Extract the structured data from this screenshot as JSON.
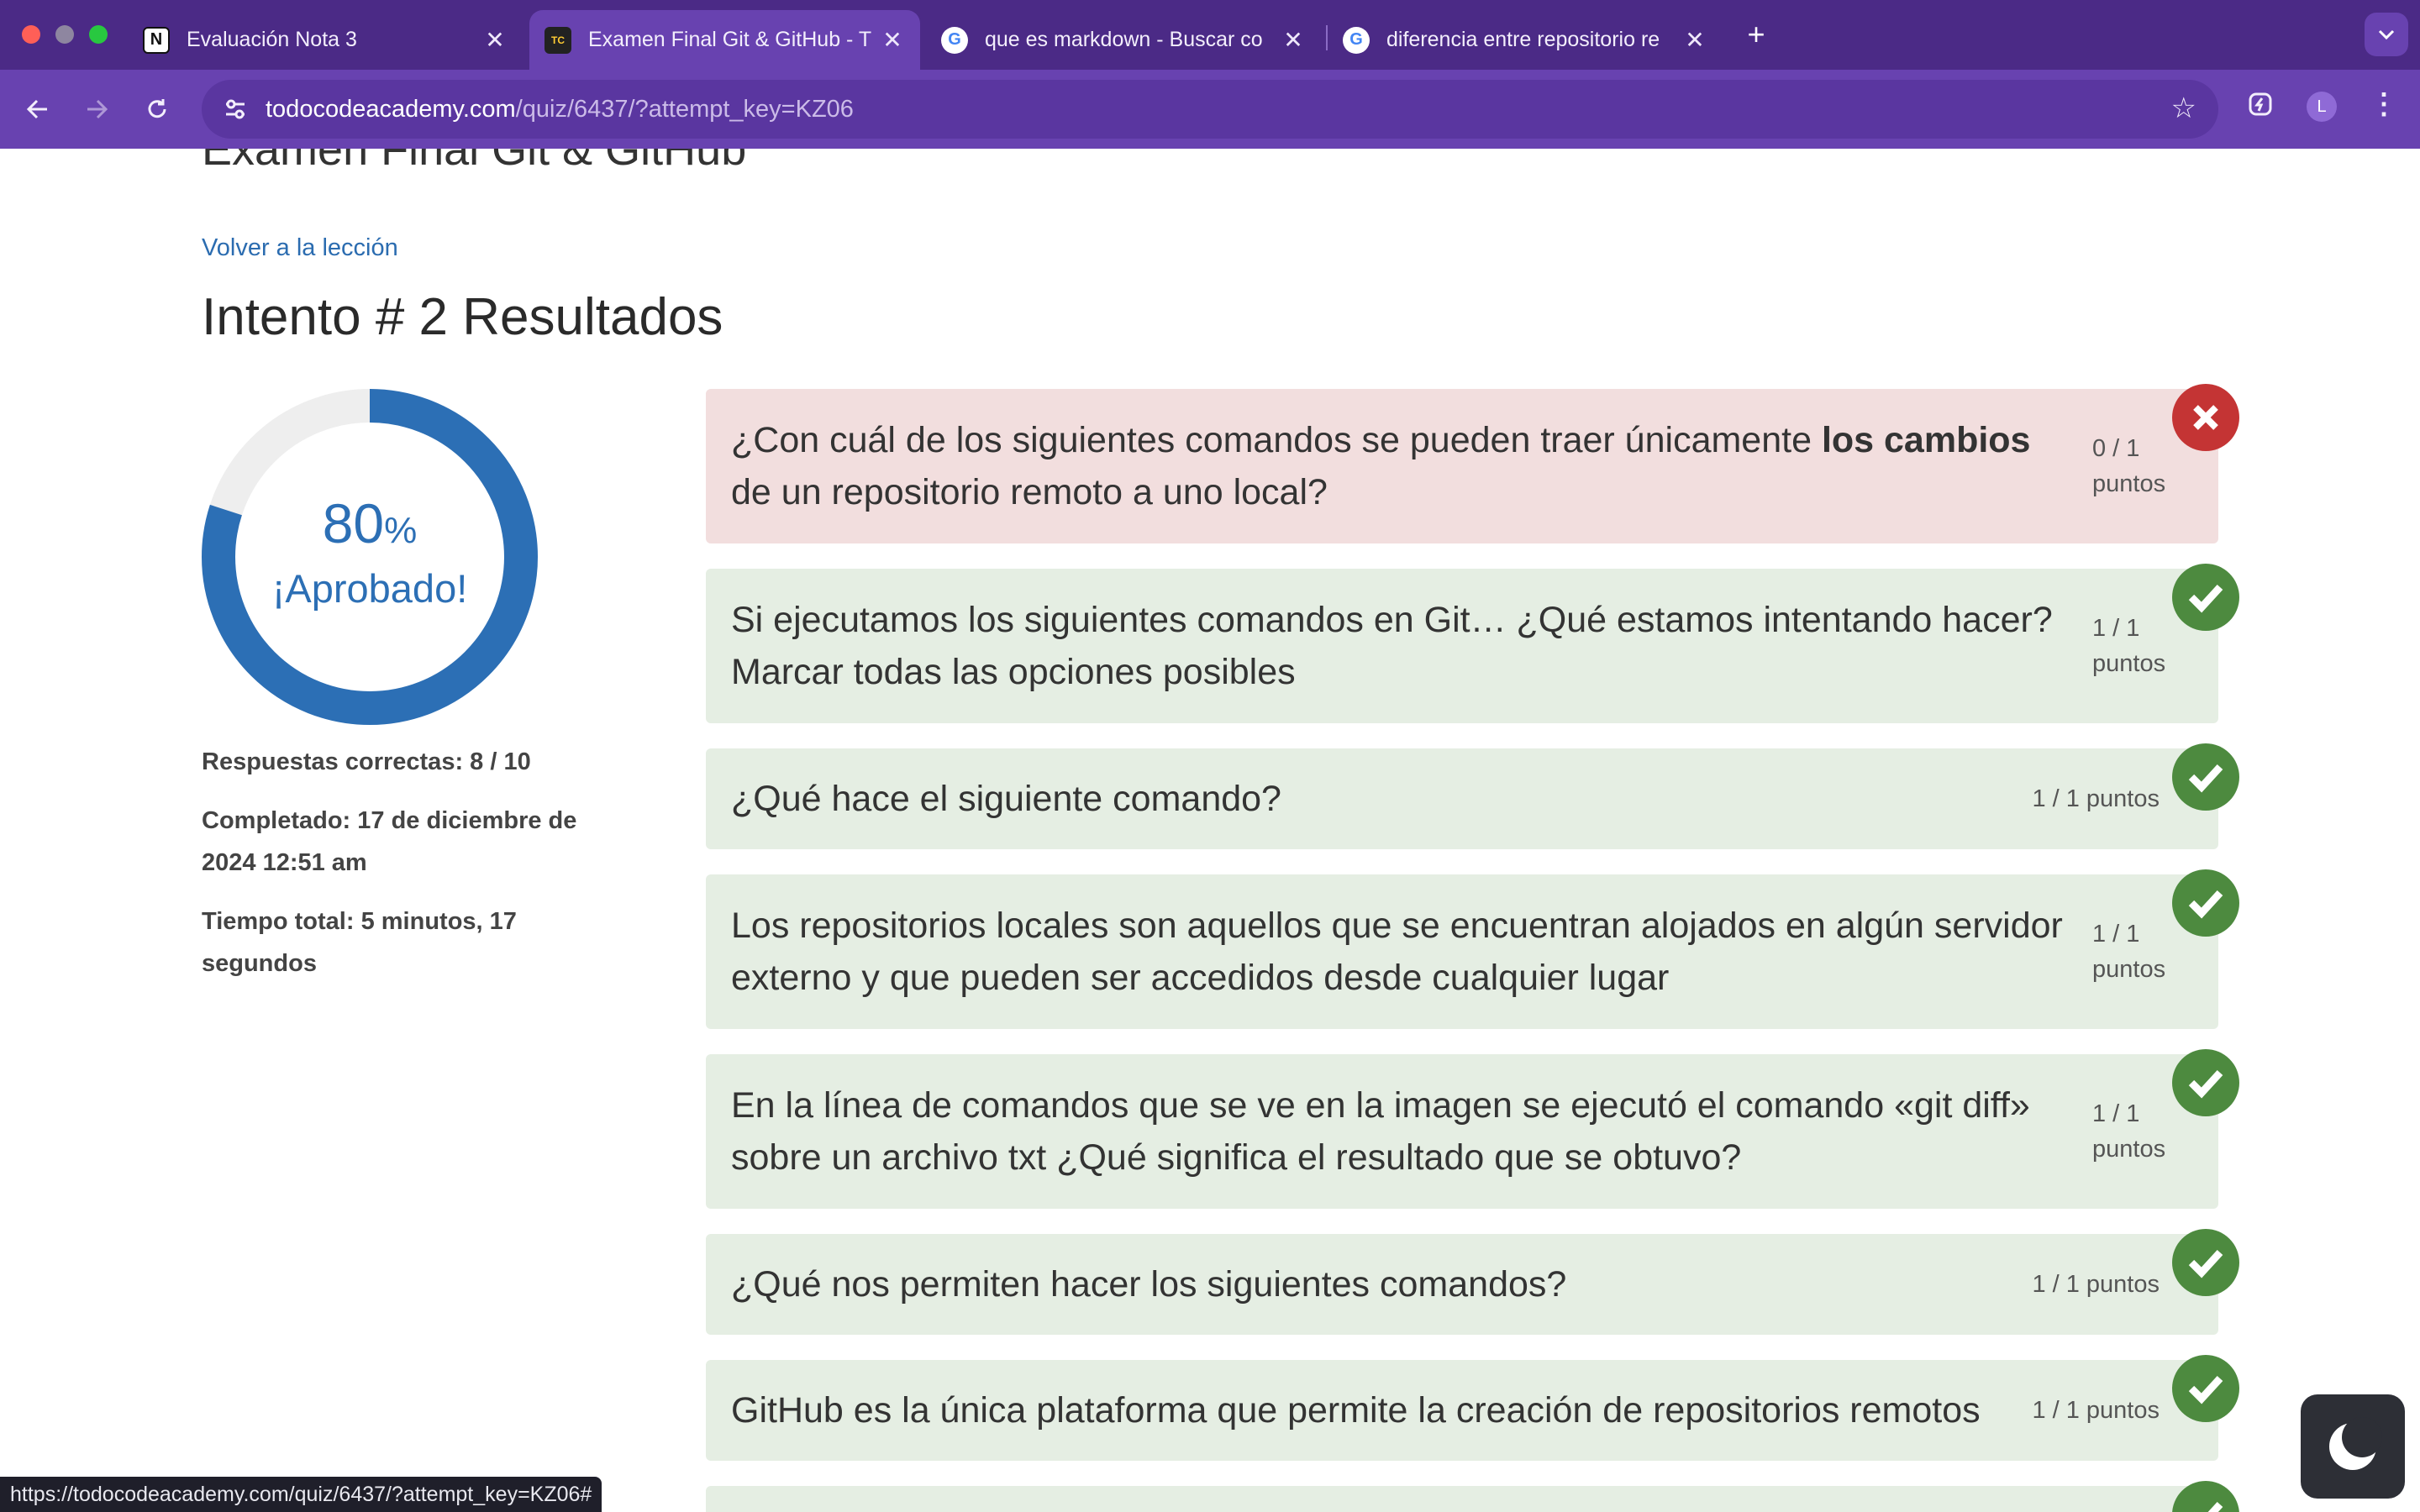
{
  "tabs": [
    {
      "title": "Evaluación Nota 3",
      "icon": "notion-icon"
    },
    {
      "title": "Examen Final Git & GitHub - T",
      "icon": "todocode-icon"
    },
    {
      "title": "que es markdown - Buscar co",
      "icon": "google-icon"
    },
    {
      "title": "diferencia entre repositorio re",
      "icon": "google-icon"
    }
  ],
  "omnibox": {
    "domain": "todocodeacademy.com",
    "path": "/quiz/6437/?attempt_key=KZ06"
  },
  "avatar_letter": "L",
  "page": {
    "exam_title": "Examen Final Git & GitHub",
    "back_link": "Volver a la lección",
    "attempt_heading": "Intento # 2 Resultados",
    "score_percent": 80,
    "score_number": "80",
    "score_symbol": "%",
    "score_status": "¡Aprobado!",
    "correct_answers": "Respuestas correctas: 8 / 10",
    "completed": "Completado: 17 de diciembre de 2024 12:51 am",
    "total_time": "Tiempo total: 5 minutos, 17 segundos"
  },
  "questions": [
    {
      "text_before": "¿Con cuál de los siguientes comandos se pueden traer únicamente ",
      "text_bold": "los cambios",
      "text_after": " de un repositorio remoto a uno local?",
      "score": "0 / 1",
      "unit": "puntos",
      "correct": false
    },
    {
      "text": "Si ejecutamos los siguientes comandos en Git… ¿Qué estamos intentando hacer? Marcar todas las opciones posibles",
      "score": "1 / 1",
      "unit": "puntos",
      "correct": true
    },
    {
      "text": "¿Qué hace el siguiente comando?",
      "score_inline": "1 / 1 puntos",
      "correct": true
    },
    {
      "text": "Los repositorios locales son aquellos que se encuentran alojados en algún servidor externo y que pueden ser accedidos desde cualquier lugar",
      "score": "1 / 1",
      "unit": "puntos",
      "correct": true
    },
    {
      "text": "En la línea de comandos que se ve en la imagen se ejecutó el comando «git diff» sobre un archivo txt ¿Qué significa el resultado que se obtuvo?",
      "score": "1 / 1",
      "unit": "puntos",
      "correct": true
    },
    {
      "text": "¿Qué nos permiten hacer los siguientes comandos?",
      "score_inline": "1 / 1 puntos",
      "correct": true
    },
    {
      "text": "GitHub es la única plataforma que permite la creación de repositorios remotos",
      "score_inline": "1 / 1 puntos",
      "correct": true
    }
  ],
  "status_url": "https://todocodeacademy.com/quiz/6437/?attempt_key=KZ06#",
  "colors": {
    "chrome": "#4b2a86",
    "toolbar": "#6842b0",
    "accent": "#2c6fb5",
    "correct_bg": "#e5eee3",
    "wrong_bg": "#f2dede",
    "ok_badge": "#4d8a3f",
    "bad_badge": "#c43434"
  }
}
